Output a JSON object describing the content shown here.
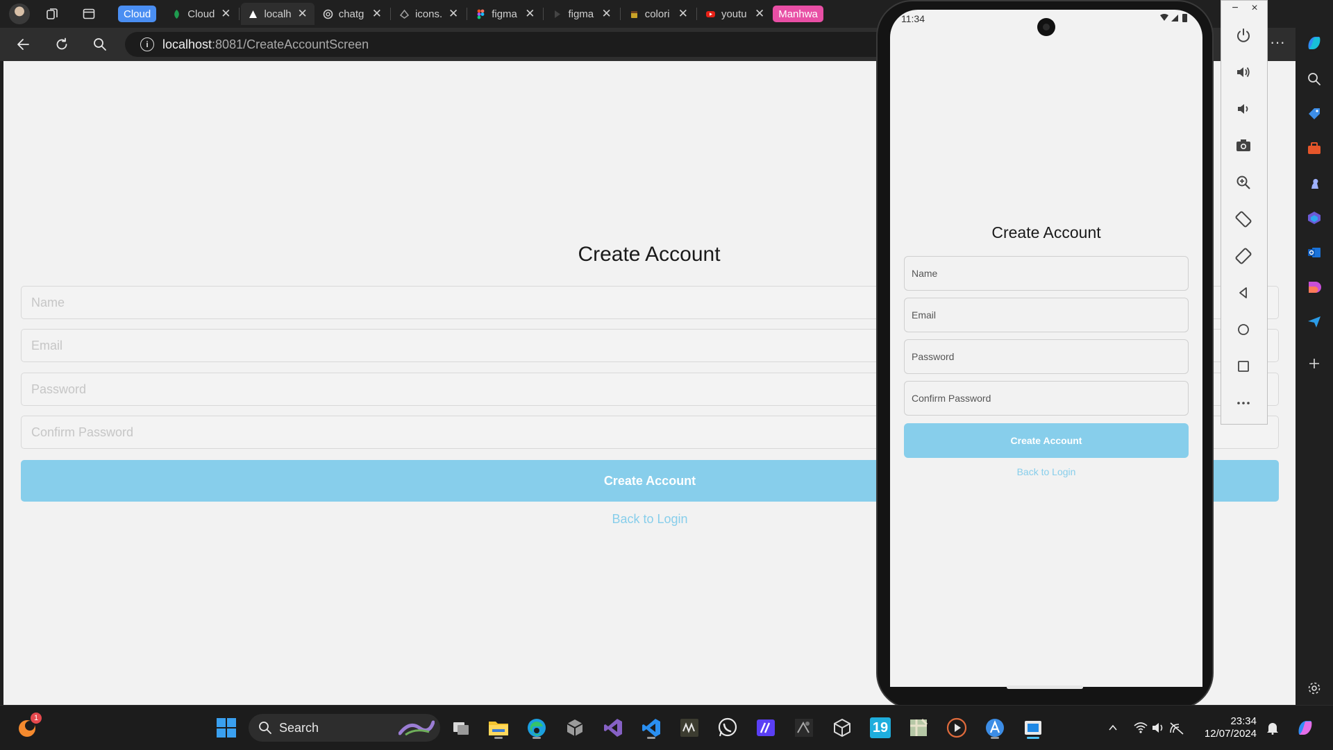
{
  "browser": {
    "tabs": [
      {
        "title": "Cloud",
        "kind": "group",
        "color": "#4a8ef2"
      },
      {
        "title": "Cloud",
        "favicon": "leaf-icon",
        "color": "#1f9b4f"
      },
      {
        "title": "localh",
        "favicon": "expo-icon",
        "color": "#ffffff",
        "active": true
      },
      {
        "title": "chatg",
        "favicon": "openai-icon",
        "color": "#cfcfcf"
      },
      {
        "title": "icons.",
        "favicon": "iconscout-icon",
        "color": "#9e9e9e"
      },
      {
        "title": "figma",
        "favicon": "figma-icon",
        "color": "#f24e1e"
      },
      {
        "title": "figma",
        "favicon": "play-icon",
        "color": "#444444"
      },
      {
        "title": "colori",
        "favicon": "palette-icon",
        "color": "#c9a227"
      },
      {
        "title": "youtu",
        "favicon": "youtube-icon",
        "color": "#e62117"
      },
      {
        "title": "Manhwa",
        "kind": "group",
        "color": "#e84fa5"
      }
    ],
    "url": {
      "host": "localhost",
      "path": ":8081/CreateAccountScreen"
    }
  },
  "app": {
    "title": "Create Account",
    "name_placeholder": "Name",
    "email_placeholder": "Email",
    "password_placeholder": "Password",
    "confirm_placeholder": "Confirm Password",
    "submit_label": "Create Account",
    "back_link": "Back to Login",
    "accent": "#87ceeb"
  },
  "phone": {
    "time": "11:34"
  },
  "emulator_window": {
    "minimize": "−",
    "close": "×"
  },
  "taskbar": {
    "search_label": "Search",
    "badge": "1",
    "time": "23:34",
    "date": "12/07/2024",
    "calendar_day": "19"
  }
}
